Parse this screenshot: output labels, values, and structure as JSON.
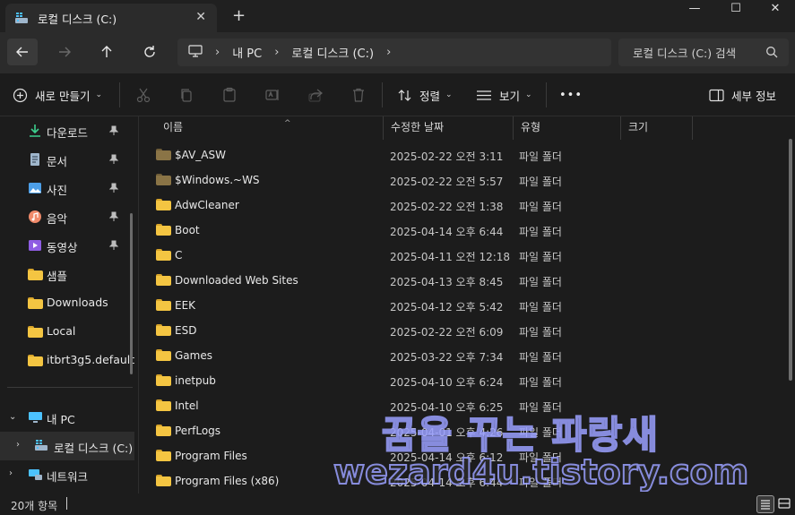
{
  "window": {
    "tab_title": "로컬 디스크 (C:)",
    "tab_close": "✕",
    "new_tab": "+",
    "minimize": "—",
    "maximize": "☐",
    "close": "✕"
  },
  "address": {
    "segments": [
      "내 PC",
      "로컬 디스크 (C:)"
    ],
    "separator": "›",
    "search_placeholder": "로컬 디스크 (C:) 검색"
  },
  "toolbar": {
    "new_label": "새로 만들기",
    "sort_label": "정렬",
    "view_label": "보기",
    "more_label": "•••",
    "details_label": "세부 정보"
  },
  "sidebar": {
    "items": [
      {
        "label": "다운로드",
        "icon": "download-icon",
        "pinned": true
      },
      {
        "label": "문서",
        "icon": "document-icon",
        "pinned": true
      },
      {
        "label": "사진",
        "icon": "pictures-icon",
        "pinned": true
      },
      {
        "label": "음악",
        "icon": "music-icon",
        "pinned": true
      },
      {
        "label": "동영상",
        "icon": "video-icon",
        "pinned": true
      },
      {
        "label": "샘플",
        "icon": "folder-icon",
        "pinned": false
      },
      {
        "label": "Downloads",
        "icon": "folder-icon",
        "pinned": false
      },
      {
        "label": "Local",
        "icon": "folder-icon",
        "pinned": false
      },
      {
        "label": "itbrt3g5.default",
        "icon": "folder-icon",
        "pinned": false
      }
    ],
    "this_pc": "내 PC",
    "local_disk": "로컬 디스크 (C:)",
    "network": "네트워크"
  },
  "columns": {
    "name": "이름",
    "date": "수정한 날짜",
    "type": "유형",
    "size": "크기"
  },
  "files": [
    {
      "name": "$AV_ASW",
      "date": "2025-02-22 오전 3:11",
      "type": "파일 폴더",
      "hidden": true
    },
    {
      "name": "$Windows.~WS",
      "date": "2025-02-22 오전 5:57",
      "type": "파일 폴더",
      "hidden": true
    },
    {
      "name": "AdwCleaner",
      "date": "2025-02-22 오전 1:38",
      "type": "파일 폴더",
      "hidden": false
    },
    {
      "name": "Boot",
      "date": "2025-04-14 오후 6:44",
      "type": "파일 폴더",
      "hidden": false
    },
    {
      "name": "C",
      "date": "2025-04-11 오전 12:18",
      "type": "파일 폴더",
      "hidden": false
    },
    {
      "name": "Downloaded Web Sites",
      "date": "2025-04-13 오후 8:45",
      "type": "파일 폴더",
      "hidden": false
    },
    {
      "name": "EEK",
      "date": "2025-04-12 오후 5:42",
      "type": "파일 폴더",
      "hidden": false
    },
    {
      "name": "ESD",
      "date": "2025-02-22 오전 6:09",
      "type": "파일 폴더",
      "hidden": false
    },
    {
      "name": "Games",
      "date": "2025-03-22 오후 7:34",
      "type": "파일 폴더",
      "hidden": false
    },
    {
      "name": "inetpub",
      "date": "2025-04-10 오후 6:24",
      "type": "파일 폴더",
      "hidden": false
    },
    {
      "name": "Intel",
      "date": "2025-04-10 오후 6:25",
      "type": "파일 폴더",
      "hidden": false
    },
    {
      "name": "PerfLogs",
      "date": "2025-04-01 오후 4:26",
      "type": "파일 폴더",
      "hidden": false
    },
    {
      "name": "Program Files",
      "date": "2025-04-14 오후 6:12",
      "type": "파일 폴더",
      "hidden": false
    },
    {
      "name": "Program Files (x86)",
      "date": "2025-04-14 오후 6:44",
      "type": "파일 폴더",
      "hidden": false
    }
  ],
  "status": {
    "count": "20개 항목"
  },
  "watermark": {
    "line1": "꿈을 꾸는 파랑새",
    "line2": "wezard4u.tistory.com"
  },
  "colors": {
    "folder": "#f4c542",
    "folder_dark": "#d9a52a",
    "folder_hidden": "#8a7446",
    "folder_hidden_dark": "#6f5d38",
    "accent": "#4cc2ff"
  }
}
